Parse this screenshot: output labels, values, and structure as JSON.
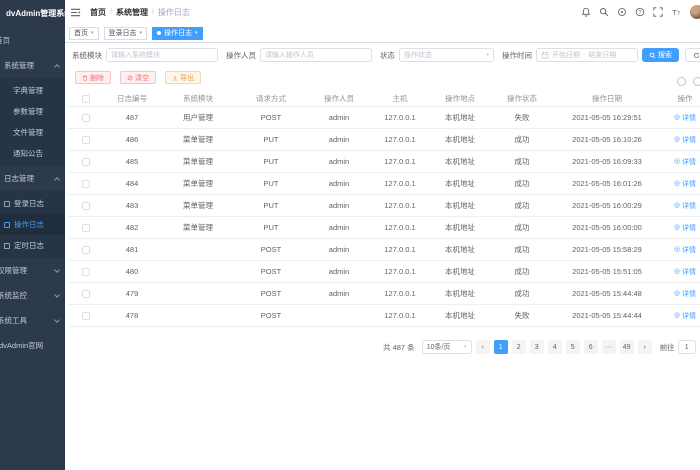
{
  "app": {
    "title": "dvAdmin管理系统",
    "accent_color": "#409eff",
    "sidebar_bg": "#2d3a4b",
    "danger_color": "#f56c6c",
    "warning_color": "#e6a23c"
  },
  "sidebar": {
    "items": [
      {
        "label": "首页"
      },
      {
        "label": "系统管理",
        "expanded": true
      },
      {
        "label": "字典管理"
      },
      {
        "label": "参数管理"
      },
      {
        "label": "文件管理"
      },
      {
        "label": "通知公告"
      },
      {
        "label": "日志管理",
        "expanded": true
      },
      {
        "label": "登录日志"
      },
      {
        "label": "操作日志",
        "active": true
      },
      {
        "label": "定时日志"
      },
      {
        "label": "权限管理"
      },
      {
        "label": "系统监控"
      },
      {
        "label": "系统工具"
      },
      {
        "label": "dvAdmin官网"
      }
    ]
  },
  "header": {
    "breadcrumb": [
      "首页",
      "系统管理",
      "操作日志"
    ],
    "icons": [
      "hamburger-icon",
      "bell-icon",
      "search-icon",
      "target-icon",
      "question-icon",
      "fullscreen-icon",
      "font-size-icon",
      "avatar"
    ]
  },
  "tabs": [
    {
      "label": "首页",
      "active": false
    },
    {
      "label": "登录日志",
      "active": false
    },
    {
      "label": "操作日志",
      "active": true
    }
  ],
  "filters": {
    "module_label": "系统模块",
    "module_placeholder": "请输入系统模块",
    "operator_label": "操作人员",
    "operator_placeholder": "请输入操作人员",
    "status_label": "状态",
    "status_placeholder": "操作状态",
    "time_label": "操作时间",
    "time_start_placeholder": "开始日期",
    "time_separator": "-",
    "time_end_placeholder": "结束日期",
    "search_button": "搜索",
    "reset_button": "重置"
  },
  "toolbar": {
    "delete_button": "删除",
    "clear_button": "清空",
    "export_button": "导出"
  },
  "table": {
    "columns": [
      "日志编号",
      "系统模块",
      "请求方式",
      "操作人员",
      "主机",
      "操作地点",
      "操作状态",
      "操作日期",
      "操作"
    ],
    "detail_link": "详情",
    "rows": [
      {
        "id": "487",
        "module": "用户管理",
        "method": "POST",
        "operator": "admin",
        "host": "127.0.0.1",
        "location": "本机地址",
        "status": "失败",
        "date": "2021-05-05 16:29:51"
      },
      {
        "id": "486",
        "module": "菜单管理",
        "method": "PUT",
        "operator": "admin",
        "host": "127.0.0.1",
        "location": "本机地址",
        "status": "成功",
        "date": "2021-05-05 16:10:26"
      },
      {
        "id": "485",
        "module": "菜单管理",
        "method": "PUT",
        "operator": "admin",
        "host": "127.0.0.1",
        "location": "本机地址",
        "status": "成功",
        "date": "2021-05-05 16:09:33"
      },
      {
        "id": "484",
        "module": "菜单管理",
        "method": "PUT",
        "operator": "admin",
        "host": "127.0.0.1",
        "location": "本机地址",
        "status": "成功",
        "date": "2021-05-05 16:01:26"
      },
      {
        "id": "483",
        "module": "菜单管理",
        "method": "PUT",
        "operator": "admin",
        "host": "127.0.0.1",
        "location": "本机地址",
        "status": "成功",
        "date": "2021-05-05 16:00:29"
      },
      {
        "id": "482",
        "module": "菜单管理",
        "method": "PUT",
        "operator": "admin",
        "host": "127.0.0.1",
        "location": "本机地址",
        "status": "成功",
        "date": "2021-05-05 16:00:00"
      },
      {
        "id": "481",
        "module": "",
        "method": "POST",
        "operator": "admin",
        "host": "127.0.0.1",
        "location": "本机地址",
        "status": "成功",
        "date": "2021-05-05 15:58:29"
      },
      {
        "id": "480",
        "module": "",
        "method": "POST",
        "operator": "admin",
        "host": "127.0.0.1",
        "location": "本机地址",
        "status": "成功",
        "date": "2021-05-05 15:51:05"
      },
      {
        "id": "479",
        "module": "",
        "method": "POST",
        "operator": "admin",
        "host": "127.0.0.1",
        "location": "本机地址",
        "status": "成功",
        "date": "2021-05-05 15:44:48"
      },
      {
        "id": "478",
        "module": "",
        "method": "POST",
        "operator": "",
        "host": "127.0.0.1",
        "location": "本机地址",
        "status": "失败",
        "date": "2021-05-05 15:44:44"
      }
    ]
  },
  "pagination": {
    "total": "共 487 条",
    "page_size": "10条/页",
    "pages": [
      "1",
      "2",
      "3",
      "4",
      "5",
      "6",
      "···",
      "49"
    ],
    "active_page": "1",
    "goto_label": "前往",
    "goto_value": "1"
  }
}
